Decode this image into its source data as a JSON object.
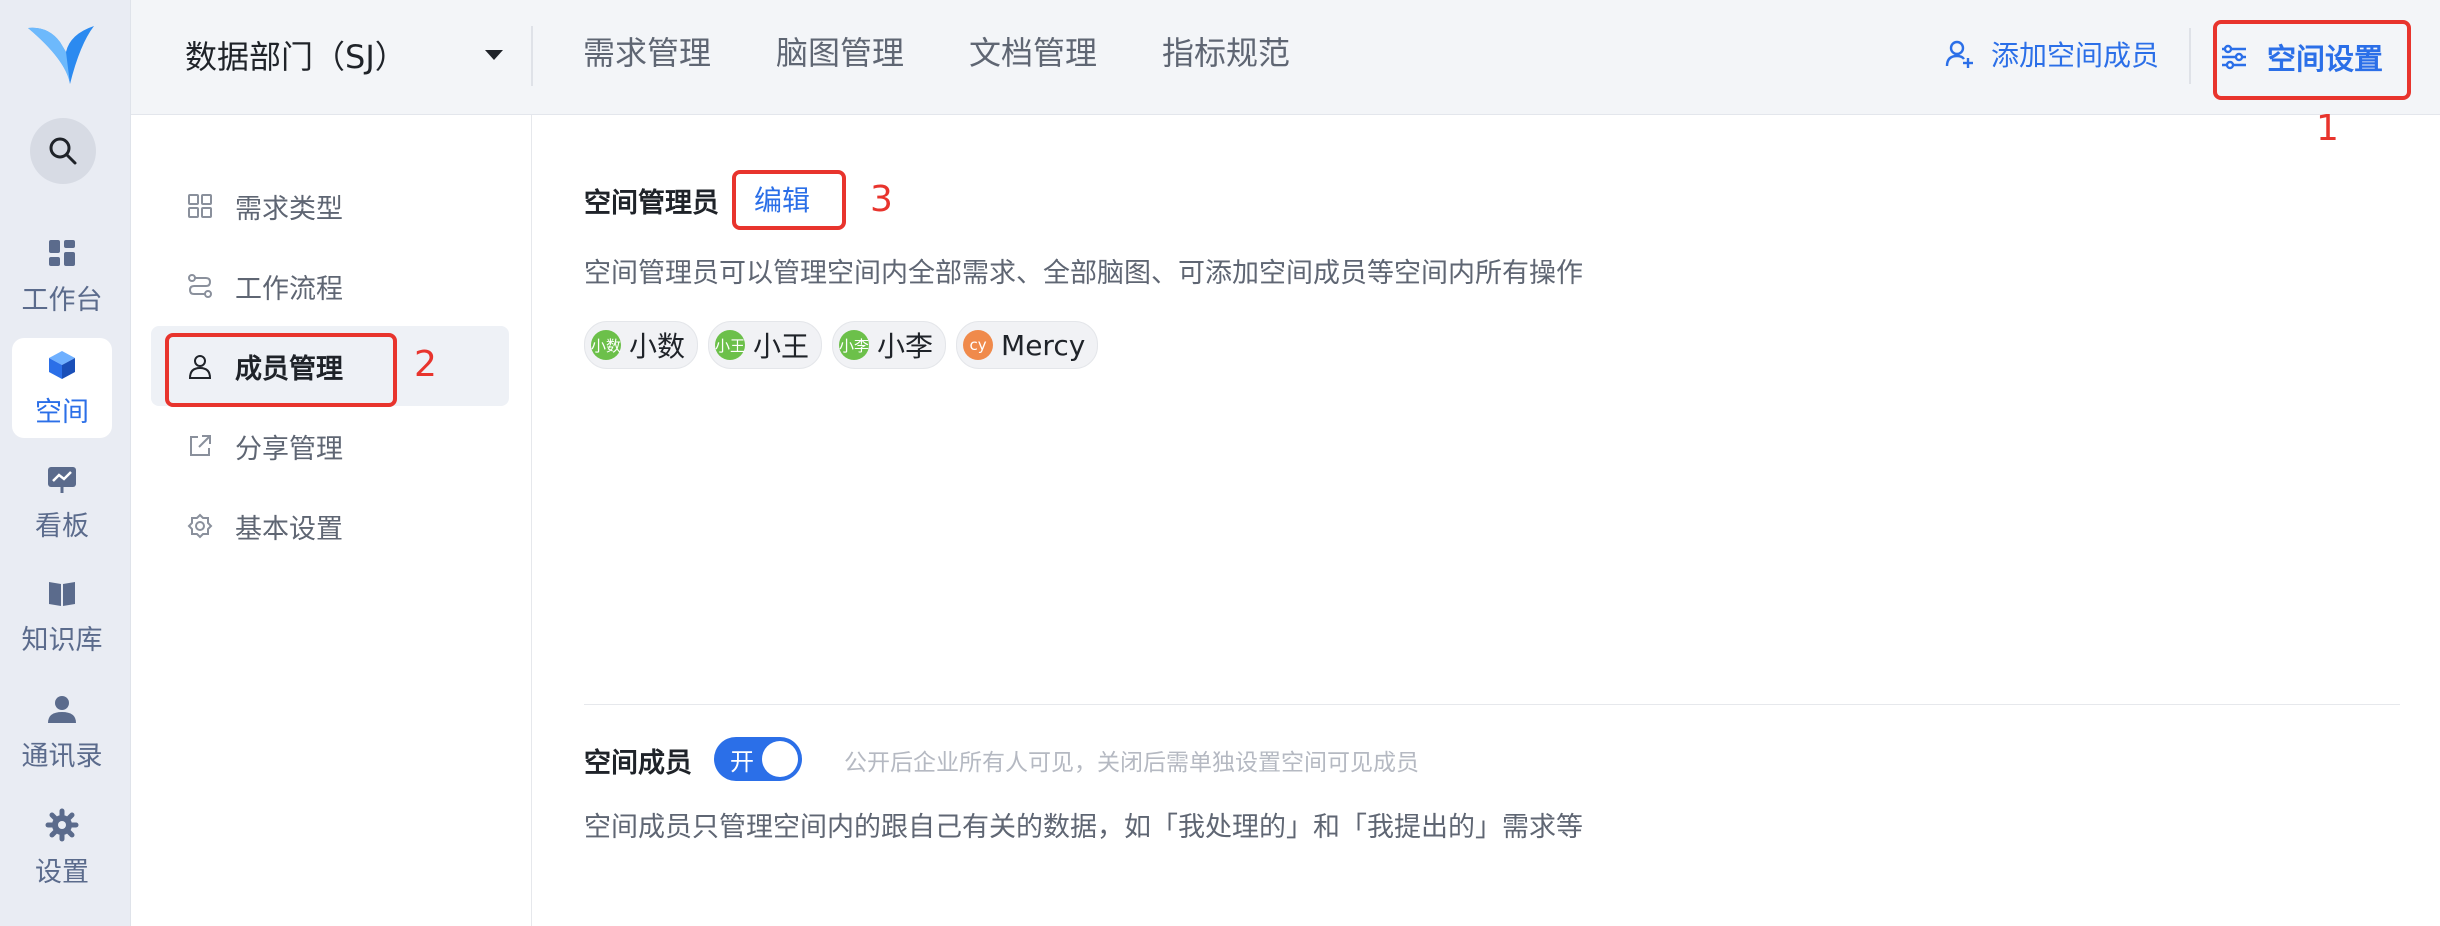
{
  "colors": {
    "accent": "#2b6fe8",
    "highlight": "#e8342d",
    "rail_bg": "#e9ecf3"
  },
  "rail": {
    "items": [
      {
        "label": "工作台",
        "icon": "dashboard-icon"
      },
      {
        "label": "空间",
        "icon": "cube-icon",
        "active": true
      },
      {
        "label": "看板",
        "icon": "chart-board-icon"
      },
      {
        "label": "知识库",
        "icon": "book-icon"
      },
      {
        "label": "通讯录",
        "icon": "contacts-icon"
      },
      {
        "label": "设置",
        "icon": "gear-icon"
      }
    ]
  },
  "header": {
    "space_name": "数据部门（SJ）",
    "nav": [
      "需求管理",
      "脑图管理",
      "文档管理",
      "指标规范"
    ],
    "add_member": "添加空间成员",
    "settings": "空间设置"
  },
  "annotations": [
    "1",
    "2",
    "3"
  ],
  "sub_nav": {
    "items": [
      {
        "label": "需求类型",
        "icon": "grid-icon"
      },
      {
        "label": "工作流程",
        "icon": "workflow-icon"
      },
      {
        "label": "成员管理",
        "icon": "user-icon",
        "active": true
      },
      {
        "label": "分享管理",
        "icon": "share-icon"
      },
      {
        "label": "基本设置",
        "icon": "gear-icon"
      }
    ]
  },
  "admins": {
    "title": "空间管理员",
    "edit": "编辑",
    "description": "空间管理员可以管理空间内全部需求、全部脑图、可添加空间成员等空间内所有操作",
    "members": [
      {
        "avatar": "小数",
        "name": "小数",
        "color": "#6cc04a"
      },
      {
        "avatar": "小王",
        "name": "小王",
        "color": "#6cc04a"
      },
      {
        "avatar": "小李",
        "name": "小李",
        "color": "#6cc04a"
      },
      {
        "avatar": "cy",
        "name": "Mercy",
        "color": "#f08a4b"
      }
    ]
  },
  "members_section": {
    "title": "空间成员",
    "toggle_label": "开",
    "toggle_on": true,
    "hint": "公开后企业所有人可见，关闭后需单独设置空间可见成员",
    "description": "空间成员只管理空间内的跟自己有关的数据，如「我处理的」和「我提出的」需求等"
  }
}
